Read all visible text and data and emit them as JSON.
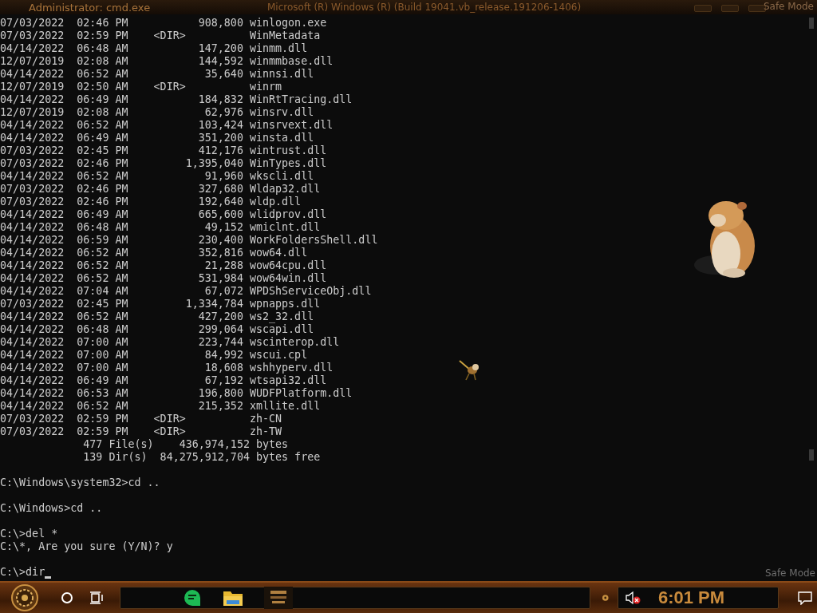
{
  "window": {
    "title": "Administrator: cmd.exe",
    "subtitle": "Microsoft (R) Windows (R) (Build 19041.vb_release.191206-1406)"
  },
  "safe_mode_labels": [
    "Safe Mode",
    "Safe Mode"
  ],
  "console": {
    "entries": [
      {
        "kind": "file",
        "date": "07/03/2022",
        "time": "02:46 PM",
        "size": "908,800",
        "name": "winlogon.exe"
      },
      {
        "kind": "dir",
        "date": "07/03/2022",
        "time": "02:59 PM",
        "size": "<DIR>",
        "name": "WinMetadata"
      },
      {
        "kind": "file",
        "date": "04/14/2022",
        "time": "06:48 AM",
        "size": "147,200",
        "name": "winmm.dll"
      },
      {
        "kind": "file",
        "date": "12/07/2019",
        "time": "02:08 AM",
        "size": "144,592",
        "name": "winmmbase.dll"
      },
      {
        "kind": "file",
        "date": "04/14/2022",
        "time": "06:52 AM",
        "size": "35,640",
        "name": "winnsi.dll"
      },
      {
        "kind": "dir",
        "date": "12/07/2019",
        "time": "02:50 AM",
        "size": "<DIR>",
        "name": "winrm"
      },
      {
        "kind": "file",
        "date": "04/14/2022",
        "time": "06:49 AM",
        "size": "184,832",
        "name": "WinRtTracing.dll"
      },
      {
        "kind": "file",
        "date": "12/07/2019",
        "time": "02:08 AM",
        "size": "62,976",
        "name": "winsrv.dll"
      },
      {
        "kind": "file",
        "date": "04/14/2022",
        "time": "06:52 AM",
        "size": "103,424",
        "name": "winsrvext.dll"
      },
      {
        "kind": "file",
        "date": "04/14/2022",
        "time": "06:49 AM",
        "size": "351,200",
        "name": "winsta.dll"
      },
      {
        "kind": "file",
        "date": "07/03/2022",
        "time": "02:45 PM",
        "size": "412,176",
        "name": "wintrust.dll"
      },
      {
        "kind": "file",
        "date": "07/03/2022",
        "time": "02:46 PM",
        "size": "1,395,040",
        "name": "WinTypes.dll"
      },
      {
        "kind": "file",
        "date": "04/14/2022",
        "time": "06:52 AM",
        "size": "91,960",
        "name": "wkscli.dll"
      },
      {
        "kind": "file",
        "date": "07/03/2022",
        "time": "02:46 PM",
        "size": "327,680",
        "name": "Wldap32.dll"
      },
      {
        "kind": "file",
        "date": "07/03/2022",
        "time": "02:46 PM",
        "size": "192,640",
        "name": "wldp.dll"
      },
      {
        "kind": "file",
        "date": "04/14/2022",
        "time": "06:49 AM",
        "size": "665,600",
        "name": "wlidprov.dll"
      },
      {
        "kind": "file",
        "date": "04/14/2022",
        "time": "06:48 AM",
        "size": "49,152",
        "name": "wmiclnt.dll"
      },
      {
        "kind": "file",
        "date": "04/14/2022",
        "time": "06:59 AM",
        "size": "230,400",
        "name": "WorkFoldersShell.dll"
      },
      {
        "kind": "file",
        "date": "04/14/2022",
        "time": "06:52 AM",
        "size": "352,816",
        "name": "wow64.dll"
      },
      {
        "kind": "file",
        "date": "04/14/2022",
        "time": "06:52 AM",
        "size": "21,288",
        "name": "wow64cpu.dll"
      },
      {
        "kind": "file",
        "date": "04/14/2022",
        "time": "06:52 AM",
        "size": "531,984",
        "name": "wow64win.dll"
      },
      {
        "kind": "file",
        "date": "04/14/2022",
        "time": "07:04 AM",
        "size": "67,072",
        "name": "WPDShServiceObj.dll"
      },
      {
        "kind": "file",
        "date": "07/03/2022",
        "time": "02:45 PM",
        "size": "1,334,784",
        "name": "wpnapps.dll"
      },
      {
        "kind": "file",
        "date": "04/14/2022",
        "time": "06:52 AM",
        "size": "427,200",
        "name": "ws2_32.dll"
      },
      {
        "kind": "file",
        "date": "04/14/2022",
        "time": "06:48 AM",
        "size": "299,064",
        "name": "wscapi.dll"
      },
      {
        "kind": "file",
        "date": "04/14/2022",
        "time": "07:00 AM",
        "size": "223,744",
        "name": "wscinterop.dll"
      },
      {
        "kind": "file",
        "date": "04/14/2022",
        "time": "07:00 AM",
        "size": "84,992",
        "name": "wscui.cpl"
      },
      {
        "kind": "file",
        "date": "04/14/2022",
        "time": "07:00 AM",
        "size": "18,608",
        "name": "wshhyperv.dll"
      },
      {
        "kind": "file",
        "date": "04/14/2022",
        "time": "06:49 AM",
        "size": "67,192",
        "name": "wtsapi32.dll"
      },
      {
        "kind": "file",
        "date": "04/14/2022",
        "time": "06:53 AM",
        "size": "196,800",
        "name": "WUDFPlatform.dll"
      },
      {
        "kind": "file",
        "date": "04/14/2022",
        "time": "06:52 AM",
        "size": "215,352",
        "name": "xmllite.dll"
      },
      {
        "kind": "dir",
        "date": "07/03/2022",
        "time": "02:59 PM",
        "size": "<DIR>",
        "name": "zh-CN"
      },
      {
        "kind": "dir",
        "date": "07/03/2022",
        "time": "02:59 PM",
        "size": "<DIR>",
        "name": "zh-TW"
      }
    ],
    "summary": [
      "             477 File(s)    436,974,152 bytes",
      "             139 Dir(s)  84,275,912,704 bytes free"
    ],
    "commands": [
      [
        "C:\\Windows\\system32>cd .."
      ],
      [
        "C:\\Windows>cd .."
      ],
      [
        "C:\\>del *",
        "C:\\*, Are you sure (Y/N)? y"
      ]
    ],
    "prompt": "C:\\>dir",
    "cursor": true
  },
  "desktop_pet": {
    "kind": "picture"
  },
  "taskbar": {
    "clock": "6:01 PM",
    "volume_muted": true
  }
}
